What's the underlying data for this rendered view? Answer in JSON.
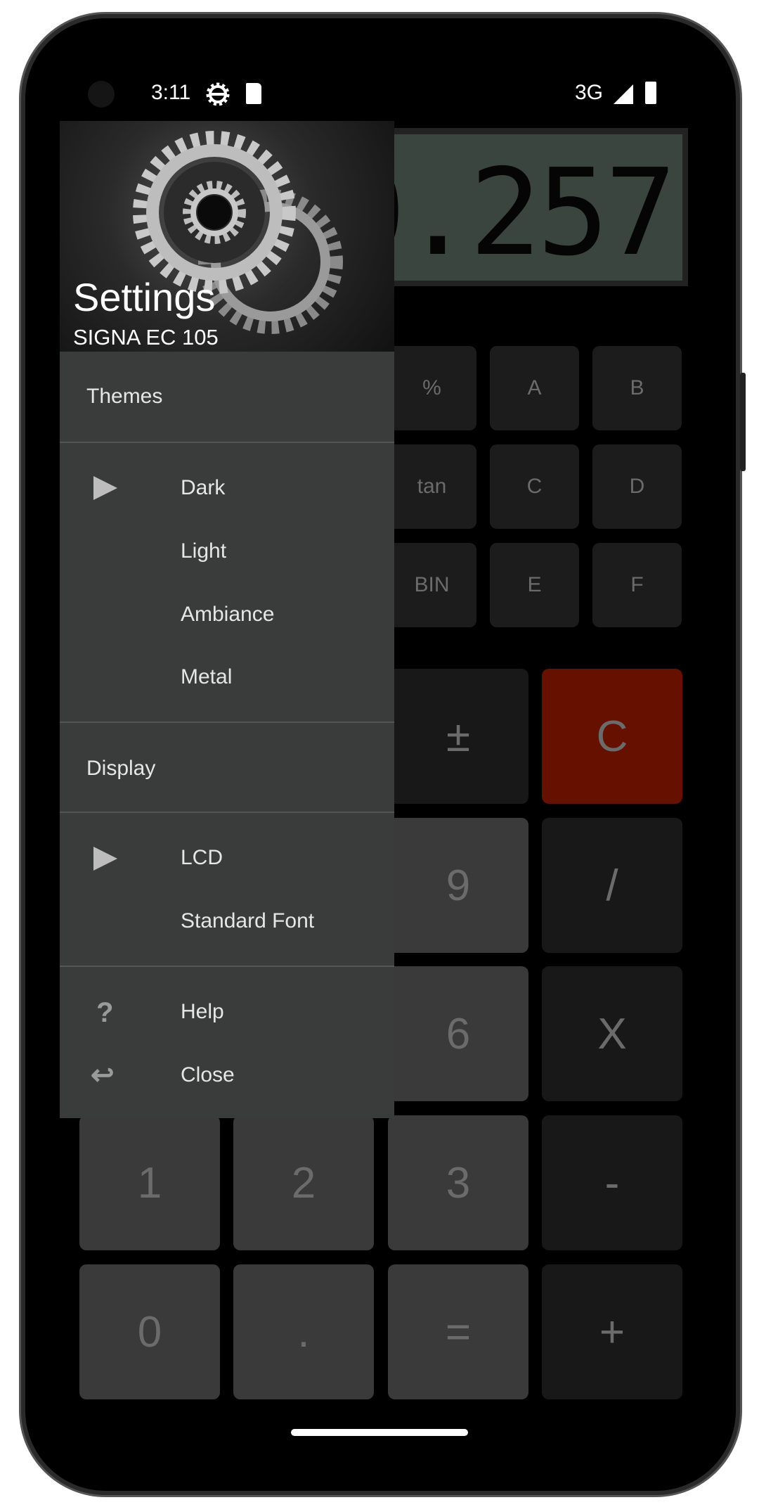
{
  "status_bar": {
    "time": "3:11",
    "network": "3G",
    "icons": [
      "settings-gear-icon",
      "sd-card-icon",
      "signal-icon",
      "battery-icon"
    ]
  },
  "display": {
    "value": "0.257"
  },
  "small_keys": [
    [
      "%",
      "A",
      "B"
    ],
    [
      "tan",
      "C",
      "D"
    ],
    [
      "BIN",
      "E",
      "F"
    ]
  ],
  "big_keys": [
    {
      "label": "±",
      "type": "op"
    },
    {
      "label": "C",
      "type": "clear"
    },
    {
      "label": "9",
      "type": "num"
    },
    {
      "label": "/",
      "type": "op"
    },
    {
      "label": "6",
      "type": "num"
    },
    {
      "label": "X",
      "type": "op"
    },
    {
      "label": "1",
      "type": "num"
    },
    {
      "label": "2",
      "type": "num"
    },
    {
      "label": "3",
      "type": "num"
    },
    {
      "label": "-",
      "type": "op"
    },
    {
      "label": "0",
      "type": "num"
    },
    {
      "label": ".",
      "type": "num"
    },
    {
      "label": "=",
      "type": "num"
    },
    {
      "label": "+",
      "type": "op"
    }
  ],
  "drawer": {
    "title": "Settings",
    "subtitle": "SIGNA EC 105",
    "themes": {
      "header": "Themes",
      "items": [
        "Dark",
        "Light",
        "Ambiance",
        "Metal"
      ],
      "selected": "Dark"
    },
    "display": {
      "header": "Display",
      "items": [
        "LCD",
        "Standard Font"
      ],
      "selected": "LCD"
    },
    "actions": [
      {
        "label": "Help",
        "icon": "help-icon"
      },
      {
        "label": "Close",
        "icon": "undo-icon"
      }
    ]
  },
  "colors": {
    "clear_key": "#661100",
    "drawer_bg": "#3a3b3b",
    "lcd_bg": "#3b453f"
  }
}
